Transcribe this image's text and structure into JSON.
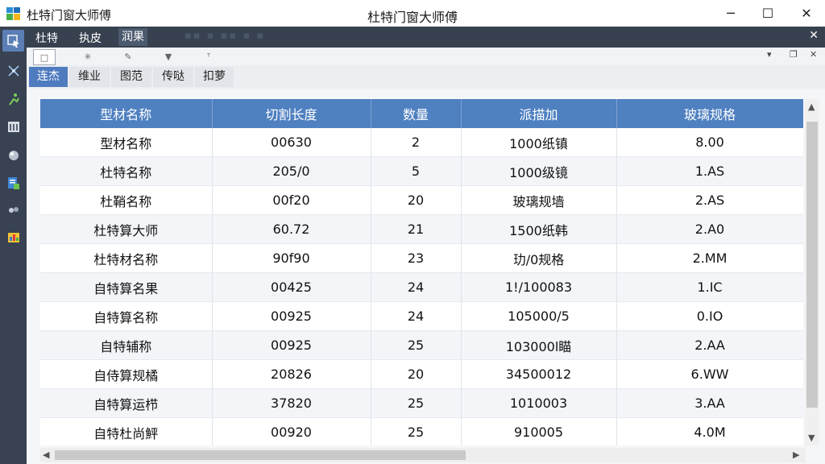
{
  "app": {
    "name": "杜特门窗大师傅",
    "window_title": "杜特门窗大师傅"
  },
  "window_controls": {
    "minimize": "─",
    "maximize": "☐",
    "close": "✕"
  },
  "menubar": {
    "items": [
      {
        "label": "杜特",
        "active": false
      },
      {
        "label": "执皮",
        "active": false
      },
      {
        "label": "润果",
        "active": true
      }
    ],
    "ghost": "▪▪ ▪ ▪▪ ▪ ▪",
    "close": "✕"
  },
  "toolbar": {
    "icons": [
      "page-icon",
      "sparkle-icon",
      "edit-icon",
      "funnel-icon",
      "pin-icon"
    ],
    "glyphs": [
      "□",
      "✳",
      "✎",
      "▼",
      "ᵀ"
    ],
    "right": {
      "dropdown": "▾",
      "restore": "❐",
      "close": "✕"
    }
  },
  "tabs": [
    {
      "label": "连杰",
      "active": true
    },
    {
      "label": "维业",
      "active": false
    },
    {
      "label": "图范",
      "active": false
    },
    {
      "label": "传哒",
      "active": false
    },
    {
      "label": "扣萝",
      "active": false
    }
  ],
  "table": {
    "columns": [
      "型材名称",
      "切割长度",
      "数量",
      "派描加",
      "玻璃规格"
    ],
    "rows": [
      [
        "型材名称",
        "00630",
        "2",
        "1000纸镇",
        "8.00"
      ],
      [
        "杜特名称",
        "205/0",
        "5",
        "1000级镜",
        "1.AS"
      ],
      [
        "杜鞘名称",
        "00f20",
        "20",
        "玻璃规墙",
        "2.AS"
      ],
      [
        "杜特算大师",
        "60.72",
        "21",
        "1500纸韩",
        "2.A0"
      ],
      [
        "杜特材名称",
        "90f90",
        "23",
        "玏/0规格",
        "2.MM"
      ],
      [
        "自特算名果",
        "00425",
        "24",
        "1!/100083",
        "1.IC"
      ],
      [
        "自特算名称",
        "00925",
        "24",
        "105000/5",
        "0.IO"
      ],
      [
        "自特辅称",
        "00925",
        "25",
        "103000l瞄",
        "2.AA"
      ],
      [
        "自侍算规橘",
        "20826",
        "20",
        "34500012",
        "6.WW"
      ],
      [
        "自特算运栉",
        "37820",
        "25",
        "1010003",
        "3.AA"
      ],
      [
        "自特杜尚鮃",
        "00920",
        "25",
        "910005",
        "4.0M"
      ]
    ]
  },
  "scroll": {
    "up": "▲",
    "down": "▼",
    "left": "◀",
    "right": "▶"
  }
}
